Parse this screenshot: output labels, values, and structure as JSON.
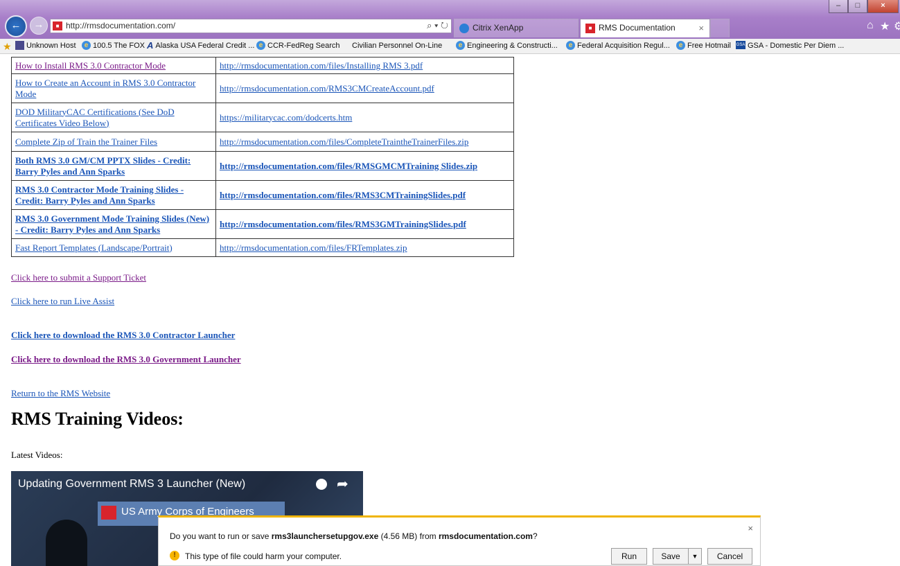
{
  "browser": {
    "address_url": "http://rmsdocumentation.com/",
    "address_tools": "⌕ ▾ ↻",
    "tabs": [
      {
        "label": "Citrix XenApp"
      },
      {
        "label": "RMS Documentation",
        "close": "×"
      }
    ],
    "window_controls": {
      "minimize": "–",
      "maximize": "□",
      "close": "×"
    },
    "favorites": [
      "Unknown Host",
      "100.5 The FOX",
      "Alaska USA Federal Credit ...",
      "CCR-FedReg Search",
      "Civilian Personnel On-Line",
      "Engineering & Constructi...",
      "Federal Acquisition Regul...",
      "Free Hotmail",
      "GSA - Domestic Per Diem ..."
    ],
    "icons": {
      "home": "home-icon",
      "favorites": "star-icon",
      "tools": "gear-icon"
    }
  },
  "doc_table": {
    "rows": [
      {
        "title": "How to Install RMS 3.0 Contractor Mode",
        "url": "http://rmsdocumentation.com/files/Installing RMS 3.pdf"
      },
      {
        "title": "How to Create an Account in RMS 3.0 Contractor Mode",
        "url": "http://rmsdocumentation.com/RMS3CMCreateAccount.pdf"
      },
      {
        "title": "DOD MilitaryCAC Certifications (See DoD Certificates Video Below)",
        "url": "https://militarycac.com/dodcerts.htm"
      },
      {
        "title": "Complete Zip of Train the Trainer Files",
        "url": "http://rmsdocumentation.com/files/CompleteTraintheTrainerFiles.zip"
      },
      {
        "title": "Both RMS 3.0 GM/CM PPTX Slides - Credit: Barry Pyles and Ann Sparks",
        "url": "http://rmsdocumentation.com/files/RMSGMCMTraining Slides.zip"
      },
      {
        "title": "RMS 3.0 Contractor Mode Training Slides - Credit: Barry Pyles and Ann Sparks",
        "url": "http://rmsdocumentation.com/files/RMS3CMTrainingSlides.pdf"
      },
      {
        "title": "RMS 3.0 Government Mode Training Slides (New) - Credit: Barry Pyles and Ann Sparks",
        "url": "http://rmsdocumentation.com/files/RMS3GMTrainingSlides.pdf"
      },
      {
        "title": "Fast Report Templates (Landscape/Portrait)",
        "url": "http://rmsdocumentation.com/files/FRTemplates.zip"
      }
    ]
  },
  "links": {
    "support": "Click here to submit a Support Ticket",
    "live_assist": "Click here to run Live Assist",
    "contractor_launcher": "Click here to download the RMS 3.0 Contractor Launcher",
    "gov_launcher": "Click here to download the RMS 3.0 Government Launcher",
    "return": "Return to the RMS Website"
  },
  "videos": {
    "heading": "RMS Training Videos:",
    "latest_label": "Latest Videos:",
    "video_title": "Updating Government RMS 3 Launcher (New)",
    "sign_text": "US Army Corps of Engineers"
  },
  "download": {
    "message_prefix": "Do you want to run or save ",
    "file_name": "rms3launchersetupgov.exe",
    "file_size": " (4.56 MB) from ",
    "source": "rmsdocumentation.com",
    "message_suffix": "?",
    "warning": "This type of file could harm your computer.",
    "run_label": "Run",
    "save_label": "Save",
    "cancel_label": "Cancel",
    "close": "×"
  }
}
